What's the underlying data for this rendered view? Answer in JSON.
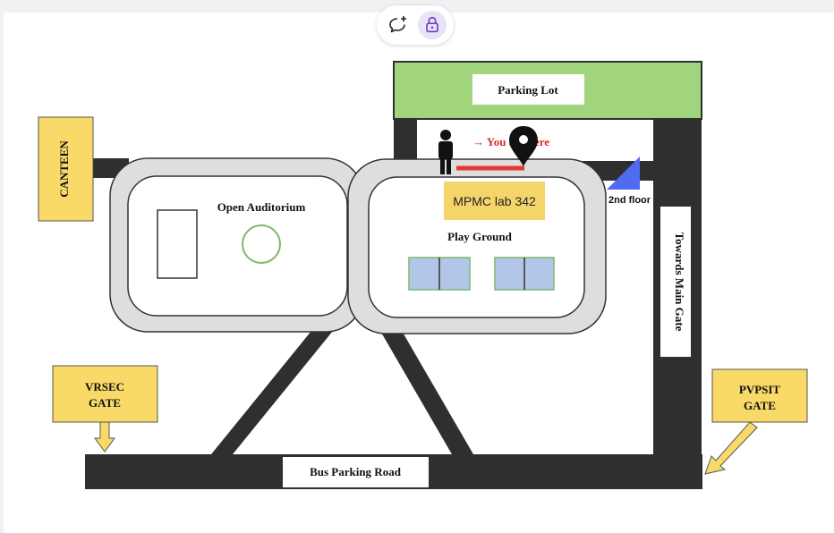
{
  "toolbar": {
    "comment_icon": "comment-add-icon",
    "lock_icon": "lock-icon"
  },
  "map": {
    "parking_lot": "Parking Lot",
    "you_are_here": "→ You are here",
    "canteen": "CANTEEN",
    "open_auditorium": "Open Auditorium",
    "play_ground": "Play Ground",
    "towards_main_gate": "Towards Main Gate",
    "vrsec_gate_line1": "VRSEC",
    "vrsec_gate_line2": "GATE",
    "pvpsit_gate_line1": "PVPSIT",
    "pvpsit_gate_line2": "GATE",
    "bus_parking_road": "Bus Parking Road"
  },
  "annotations": {
    "lab_label": "MPMC lab 342",
    "floor_label": "2nd floor",
    "lab_color": "#f5d46a",
    "path_color": "#e53935",
    "stair_color": "#4f6cf0"
  },
  "colors": {
    "road": "#2f2f2f",
    "green": "#a0d57e",
    "gate_yellow": "#f9d968",
    "court_blue": "#b2c6e8",
    "circle_green": "#7cb86a"
  }
}
